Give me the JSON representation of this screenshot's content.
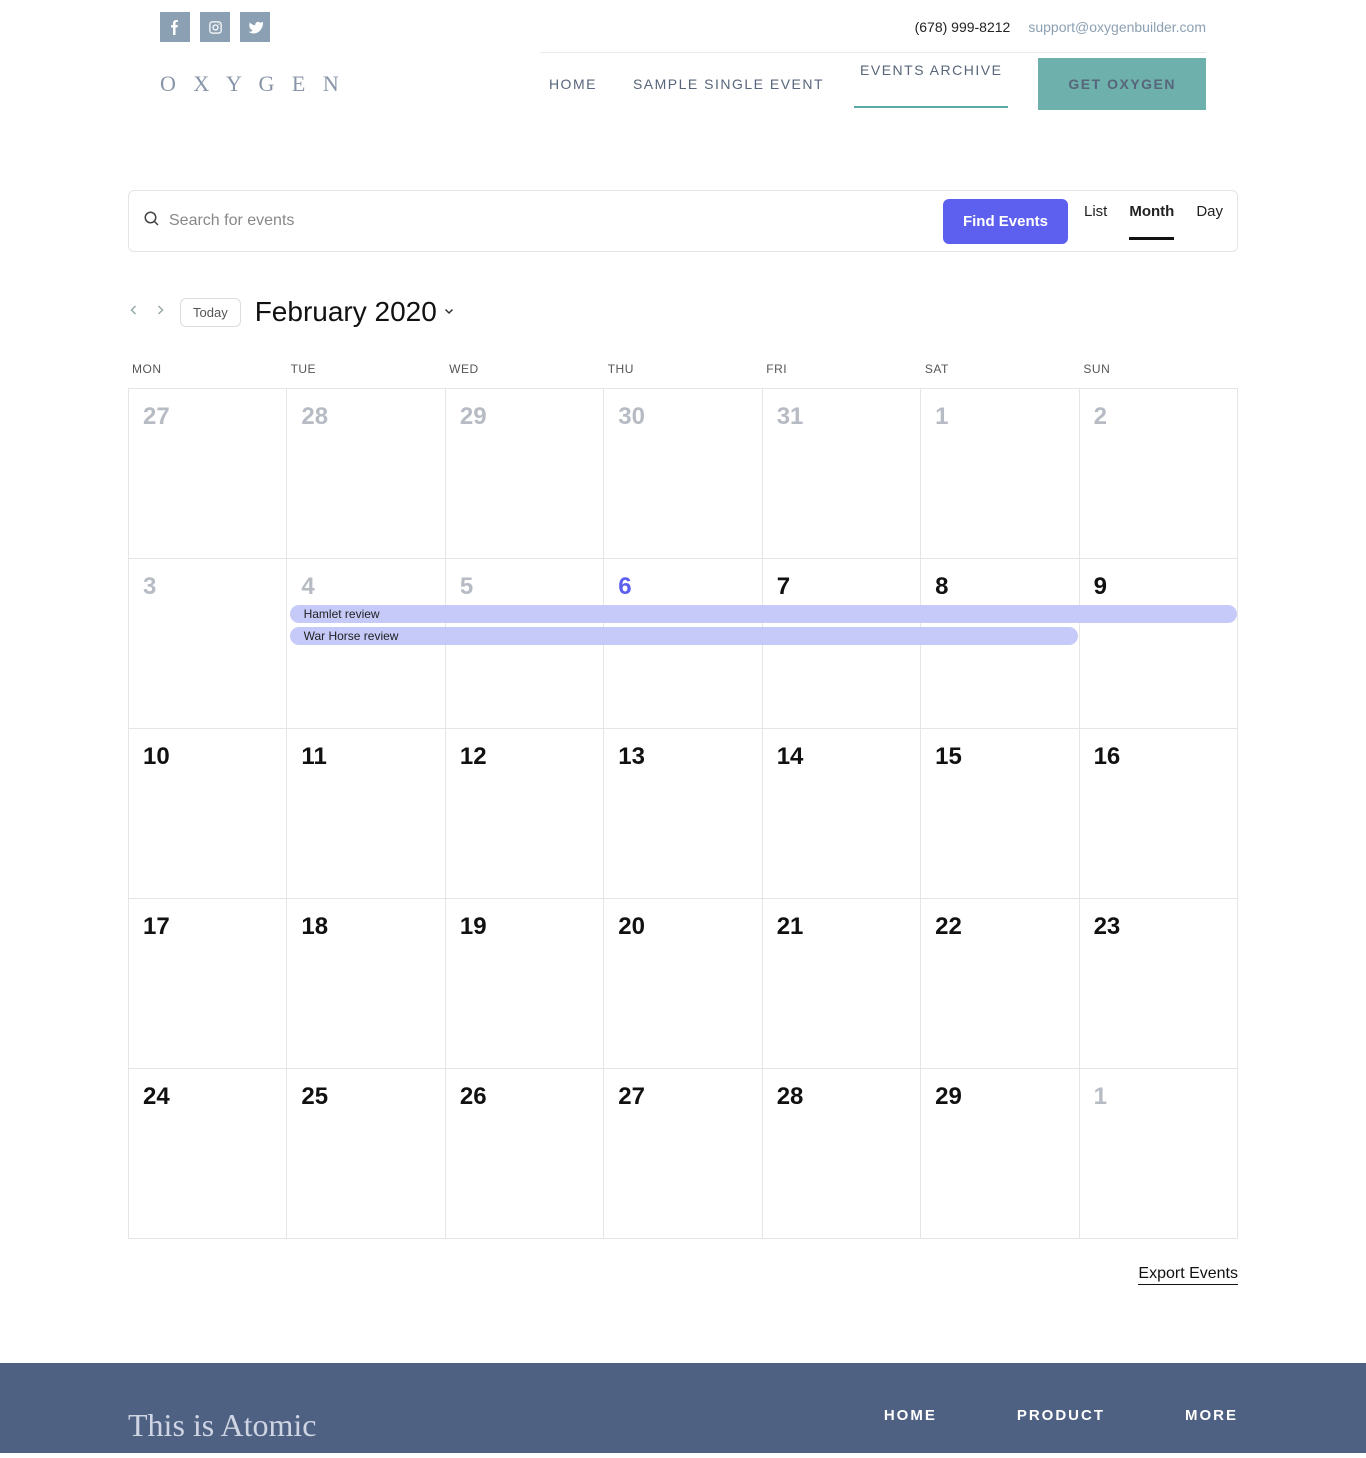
{
  "topbar": {
    "phone": "(678) 999-8212",
    "email": "support@oxygenbuilder.com"
  },
  "logo": "O X Y G E N",
  "nav": {
    "home": "HOME",
    "sample": "SAMPLE SINGLE EVENT",
    "archive": "EVENTS ARCHIVE",
    "get": "GET OXYGEN"
  },
  "search": {
    "placeholder": "Search for events",
    "find_label": "Find Events",
    "tabs": {
      "list": "List",
      "month": "Month",
      "day": "Day"
    }
  },
  "toolbar": {
    "today": "Today",
    "month": "February 2020"
  },
  "dow": [
    "MON",
    "TUE",
    "WED",
    "THU",
    "FRI",
    "SAT",
    "SUN"
  ],
  "weeks": [
    [
      {
        "n": "27",
        "cls": "prev"
      },
      {
        "n": "28",
        "cls": "prev"
      },
      {
        "n": "29",
        "cls": "prev"
      },
      {
        "n": "30",
        "cls": "prev"
      },
      {
        "n": "31",
        "cls": "prev"
      },
      {
        "n": "1",
        "cls": "past"
      },
      {
        "n": "2",
        "cls": "past"
      }
    ],
    [
      {
        "n": "3",
        "cls": "past"
      },
      {
        "n": "4",
        "cls": "past"
      },
      {
        "n": "5",
        "cls": "past"
      },
      {
        "n": "6",
        "cls": "today"
      },
      {
        "n": "7",
        "cls": ""
      },
      {
        "n": "8",
        "cls": ""
      },
      {
        "n": "9",
        "cls": ""
      }
    ],
    [
      {
        "n": "10",
        "cls": ""
      },
      {
        "n": "11",
        "cls": ""
      },
      {
        "n": "12",
        "cls": ""
      },
      {
        "n": "13",
        "cls": ""
      },
      {
        "n": "14",
        "cls": ""
      },
      {
        "n": "15",
        "cls": ""
      },
      {
        "n": "16",
        "cls": ""
      }
    ],
    [
      {
        "n": "17",
        "cls": ""
      },
      {
        "n": "18",
        "cls": ""
      },
      {
        "n": "19",
        "cls": ""
      },
      {
        "n": "20",
        "cls": ""
      },
      {
        "n": "21",
        "cls": ""
      },
      {
        "n": "22",
        "cls": ""
      },
      {
        "n": "23",
        "cls": ""
      }
    ],
    [
      {
        "n": "24",
        "cls": ""
      },
      {
        "n": "25",
        "cls": ""
      },
      {
        "n": "26",
        "cls": ""
      },
      {
        "n": "27",
        "cls": ""
      },
      {
        "n": "28",
        "cls": ""
      },
      {
        "n": "29",
        "cls": ""
      },
      {
        "n": "1",
        "cls": "prev"
      }
    ]
  ],
  "events": [
    {
      "title": "Hamlet review",
      "startCol": 1,
      "span": 6,
      "row": 1,
      "offset": 0
    },
    {
      "title": "War Horse review",
      "startCol": 1,
      "span": 5,
      "row": 1,
      "offset": 1
    }
  ],
  "export_label": "Export Events",
  "footer": {
    "title": "This is Atomic",
    "cols": [
      "HOME",
      "PRODUCT",
      "MORE"
    ]
  }
}
